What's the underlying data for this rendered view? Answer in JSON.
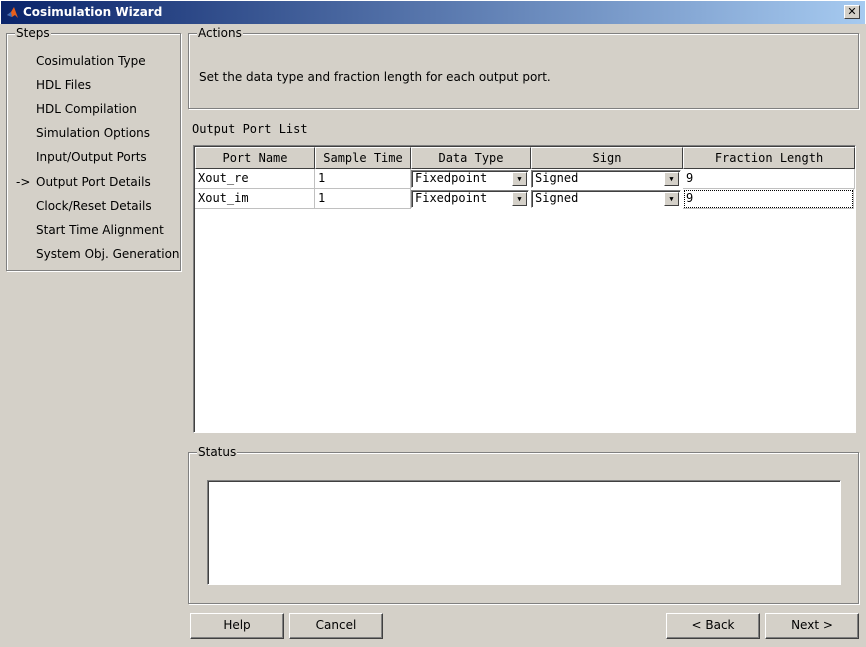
{
  "window": {
    "title": "Cosimulation Wizard",
    "close": "✕"
  },
  "steps": {
    "legend": "Steps",
    "current_marker": "->",
    "items": [
      "Cosimulation Type",
      "HDL Files",
      "HDL Compilation",
      "Simulation Options",
      "Input/Output Ports",
      "Output Port Details",
      "Clock/Reset Details",
      "Start Time Alignment",
      "System Obj. Generation"
    ]
  },
  "actions": {
    "legend": "Actions",
    "text": "Set the data type and fraction length for each output port."
  },
  "port_list": {
    "label": "Output Port List",
    "columns": [
      "Port Name",
      "Sample Time",
      "Data Type",
      "Sign",
      "Fraction Length"
    ],
    "rows": [
      {
        "name": "Xout_re",
        "sample_time": "1",
        "data_type": "Fixedpoint",
        "sign": "Signed",
        "fraction_length": "9"
      },
      {
        "name": "Xout_im",
        "sample_time": "1",
        "data_type": "Fixedpoint",
        "sign": "Signed",
        "fraction_length": "9"
      }
    ]
  },
  "status": {
    "legend": "Status",
    "text": ""
  },
  "buttons": {
    "help": "Help",
    "cancel": "Cancel",
    "back": "< Back",
    "next": "Next >"
  }
}
